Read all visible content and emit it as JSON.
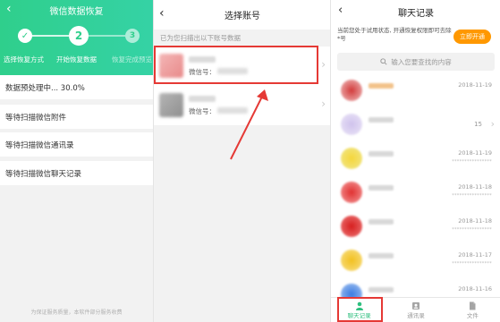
{
  "panel1": {
    "title": "微信数据恢复",
    "steps": [
      {
        "number": "✓",
        "label": "选择恢复方式"
      },
      {
        "number": "2",
        "label": "开始恢复数据"
      },
      {
        "number": "3",
        "label": "恢复完成预览"
      }
    ],
    "progress_text": "数据预处理中... 30.0%",
    "progress_percent": 30.0,
    "rows": [
      "等待扫描微信附件",
      "等待扫描微信通讯录",
      "等待扫描微信聊天记录"
    ],
    "footer": "为保证服务质量，本软件部分服务收费"
  },
  "panel2": {
    "title": "选择账号",
    "hint": "已为您扫描出以下账号数据",
    "accounts": [
      {
        "wx_label": "微信号："
      },
      {
        "wx_label": "微信号："
      }
    ]
  },
  "panel3": {
    "title": "聊天记录",
    "notice": "当前您处于试用状态, 开通恢复权限即可去除*号",
    "open_button": "立即开通",
    "search_placeholder": "输入您要查找的内容",
    "chats": [
      {
        "time": "2018-11-19",
        "preview": "",
        "count": ""
      },
      {
        "time": "",
        "preview": "",
        "count": "15"
      },
      {
        "time": "2018-11-19",
        "preview": "****************",
        "count": ""
      },
      {
        "time": "2018-11-18",
        "preview": "****************",
        "count": ""
      },
      {
        "time": "2018-11-18",
        "preview": "****************",
        "count": ""
      },
      {
        "time": "2018-11-17",
        "preview": "****************",
        "count": ""
      },
      {
        "time": "2018-11-16",
        "preview": "",
        "count": ""
      }
    ],
    "tabs": [
      {
        "label": "聊天记录",
        "icon": "person-icon"
      },
      {
        "label": "通讯录",
        "icon": "contacts-icon"
      },
      {
        "label": "文件",
        "icon": "file-icon"
      }
    ]
  },
  "colors": {
    "brand_green": "#2fcf8c",
    "accent_orange": "#ff9800",
    "highlight_red": "#e53935"
  }
}
